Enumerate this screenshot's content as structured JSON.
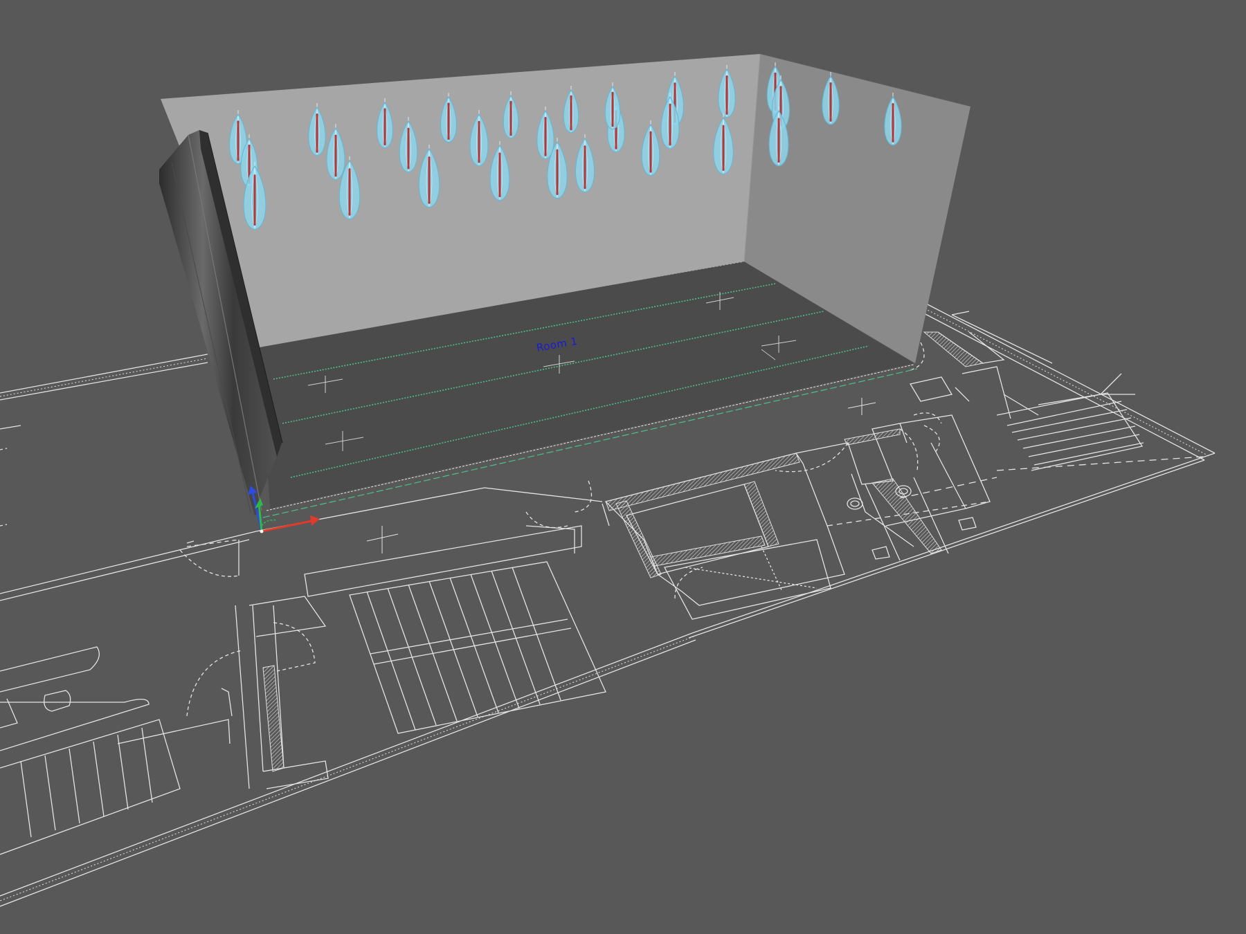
{
  "viewport": {
    "background": "#585858",
    "line_color": "#e8e8e8",
    "wall_color": "#a6a6a6",
    "side_wall_color": "#8a8a8a",
    "floor_color": "#4b4b4b",
    "curtain_color": "#3c3c3c",
    "pendant_color": "#8fd3ea",
    "pendant_core_color": "#b03838",
    "guide_line_color": "#4cc08a"
  },
  "room": {
    "label": "Room 1"
  },
  "axis_gizmo": {
    "x_color": "#e03a2a",
    "y_color": "#2fb84a",
    "z_color": "#2c4be0"
  },
  "pendants": {
    "count": 29,
    "icon": "teardrop-pendant-icon"
  }
}
